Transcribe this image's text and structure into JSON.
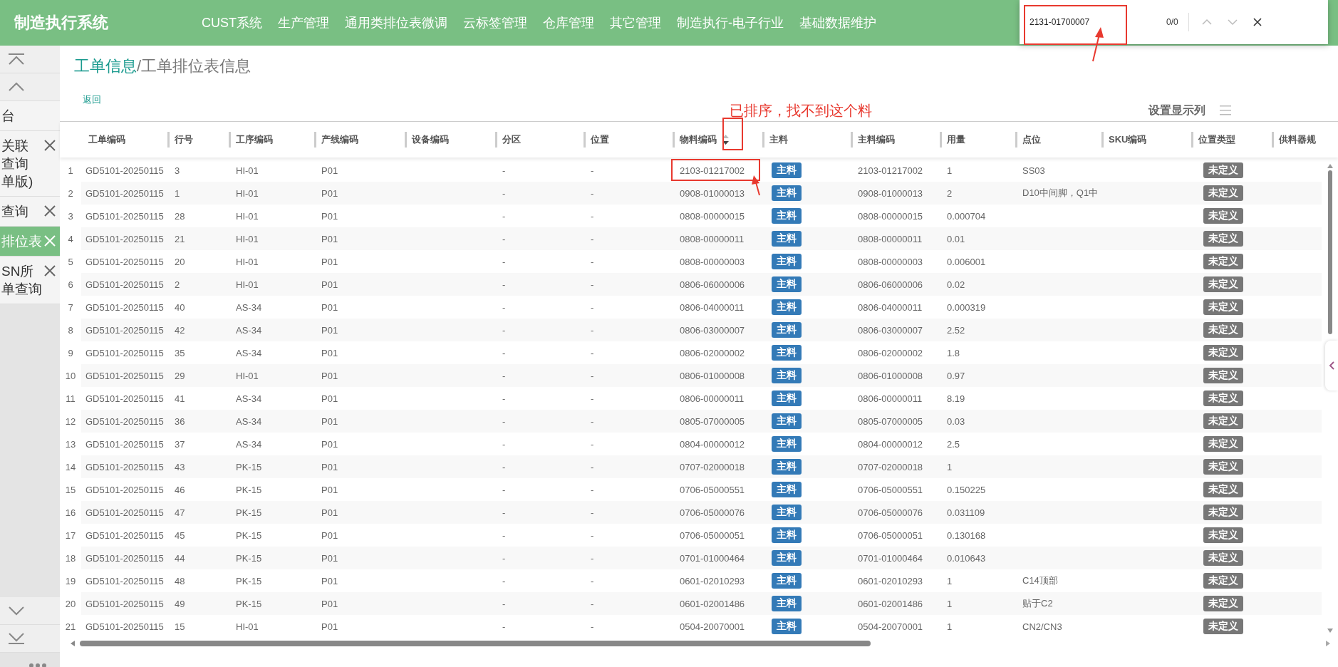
{
  "app": {
    "title": "制造执行系统"
  },
  "nav": [
    "CUST系统",
    "生产管理",
    "通用类排位表微调",
    "云标签管理",
    "仓库管理",
    "其它管理",
    "制造执行-电子行业",
    "基础数据维护"
  ],
  "find_bar": {
    "value": "2131-01700007",
    "count": "0/0"
  },
  "sidebar": {
    "tabs": [
      {
        "label_lines": [
          "台"
        ],
        "closable": false,
        "selected": false
      },
      {
        "label_lines": [
          "关联",
          "查询",
          "单版)"
        ],
        "closable": true,
        "selected": false
      },
      {
        "label_lines": [
          "查询"
        ],
        "closable": true,
        "selected": false
      },
      {
        "label_lines": [
          "排位表"
        ],
        "closable": true,
        "selected": true
      },
      {
        "label_lines": [
          "SN所",
          "单查询"
        ],
        "closable": true,
        "selected": false
      }
    ]
  },
  "breadcrumb": [
    {
      "label": "工单信息",
      "kind": "link"
    },
    {
      "label": "/工单排位表信息",
      "kind": "current"
    }
  ],
  "back_link": "返回",
  "column_settings": "设置显示列",
  "annotation": {
    "text": "已排序，找不到这个料"
  },
  "table": {
    "columns": [
      {
        "label": "工单编码"
      },
      {
        "label": "行号"
      },
      {
        "label": "工序编码"
      },
      {
        "label": "产线编码"
      },
      {
        "label": "设备编码"
      },
      {
        "label": "分区"
      },
      {
        "label": "位置"
      },
      {
        "label": "物料编码",
        "sorted_descending": true
      },
      {
        "label": "主料"
      },
      {
        "label": "主料编码"
      },
      {
        "label": "用量"
      },
      {
        "label": "点位"
      },
      {
        "label": "SKU编码"
      },
      {
        "label": "位置类型"
      },
      {
        "label": "供料器规"
      }
    ],
    "rows": [
      {
        "index": "1",
        "order_code": "GD5101-20250115",
        "line_no": "3",
        "process_code": "HI-01",
        "line_code": "P01",
        "zone": "-",
        "position": "-",
        "material_code": "2103-01217002",
        "main_material": "主料",
        "main_code": "2103-01217002",
        "usage": "1",
        "point": "SS03",
        "position_type": "未定义"
      },
      {
        "index": "2",
        "order_code": "GD5101-20250115",
        "line_no": "1",
        "process_code": "HI-01",
        "line_code": "P01",
        "zone": "-",
        "position": "-",
        "material_code": "0908-01000013",
        "main_material": "主料",
        "main_code": "0908-01000013",
        "usage": "2",
        "point": "D10中间脚，Q1中",
        "position_type": "未定义"
      },
      {
        "index": "3",
        "order_code": "GD5101-20250115",
        "line_no": "28",
        "process_code": "HI-01",
        "line_code": "P01",
        "zone": "-",
        "position": "-",
        "material_code": "0808-00000015",
        "main_material": "主料",
        "main_code": "0808-00000015",
        "usage": "0.000704",
        "position_type": "未定义"
      },
      {
        "index": "4",
        "order_code": "GD5101-20250115",
        "line_no": "21",
        "process_code": "HI-01",
        "line_code": "P01",
        "zone": "-",
        "position": "-",
        "material_code": "0808-00000011",
        "main_material": "主料",
        "main_code": "0808-00000011",
        "usage": "0.01",
        "position_type": "未定义"
      },
      {
        "index": "5",
        "order_code": "GD5101-20250115",
        "line_no": "20",
        "process_code": "HI-01",
        "line_code": "P01",
        "zone": "-",
        "position": "-",
        "material_code": "0808-00000003",
        "main_material": "主料",
        "main_code": "0808-00000003",
        "usage": "0.006001",
        "position_type": "未定义"
      },
      {
        "index": "6",
        "order_code": "GD5101-20250115",
        "line_no": "2",
        "process_code": "HI-01",
        "line_code": "P01",
        "zone": "-",
        "position": "-",
        "material_code": "0806-06000006",
        "main_material": "主料",
        "main_code": "0806-06000006",
        "usage": "0.02",
        "position_type": "未定义"
      },
      {
        "index": "7",
        "order_code": "GD5101-20250115",
        "line_no": "40",
        "process_code": "AS-34",
        "line_code": "P01",
        "zone": "-",
        "position": "-",
        "material_code": "0806-04000011",
        "main_material": "主料",
        "main_code": "0806-04000011",
        "usage": "0.000319",
        "position_type": "未定义"
      },
      {
        "index": "8",
        "order_code": "GD5101-20250115",
        "line_no": "42",
        "process_code": "AS-34",
        "line_code": "P01",
        "zone": "-",
        "position": "-",
        "material_code": "0806-03000007",
        "main_material": "主料",
        "main_code": "0806-03000007",
        "usage": "2.52",
        "position_type": "未定义"
      },
      {
        "index": "9",
        "order_code": "GD5101-20250115",
        "line_no": "35",
        "process_code": "AS-34",
        "line_code": "P01",
        "zone": "-",
        "position": "-",
        "material_code": "0806-02000002",
        "main_material": "主料",
        "main_code": "0806-02000002",
        "usage": "1.8",
        "position_type": "未定义"
      },
      {
        "index": "10",
        "order_code": "GD5101-20250115",
        "line_no": "29",
        "process_code": "HI-01",
        "line_code": "P01",
        "zone": "-",
        "position": "-",
        "material_code": "0806-01000008",
        "main_material": "主料",
        "main_code": "0806-01000008",
        "usage": "0.97",
        "position_type": "未定义"
      },
      {
        "index": "11",
        "order_code": "GD5101-20250115",
        "line_no": "41",
        "process_code": "AS-34",
        "line_code": "P01",
        "zone": "-",
        "position": "-",
        "material_code": "0806-00000011",
        "main_material": "主料",
        "main_code": "0806-00000011",
        "usage": "8.19",
        "position_type": "未定义"
      },
      {
        "index": "12",
        "order_code": "GD5101-20250115",
        "line_no": "36",
        "process_code": "AS-34",
        "line_code": "P01",
        "zone": "-",
        "position": "-",
        "material_code": "0805-07000005",
        "main_material": "主料",
        "main_code": "0805-07000005",
        "usage": "0.03",
        "position_type": "未定义"
      },
      {
        "index": "13",
        "order_code": "GD5101-20250115",
        "line_no": "37",
        "process_code": "AS-34",
        "line_code": "P01",
        "zone": "-",
        "position": "-",
        "material_code": "0804-00000012",
        "main_material": "主料",
        "main_code": "0804-00000012",
        "usage": "2.5",
        "position_type": "未定义"
      },
      {
        "index": "14",
        "order_code": "GD5101-20250115",
        "line_no": "43",
        "process_code": "PK-15",
        "line_code": "P01",
        "zone": "-",
        "position": "-",
        "material_code": "0707-02000018",
        "main_material": "主料",
        "main_code": "0707-02000018",
        "usage": "1",
        "position_type": "未定义"
      },
      {
        "index": "15",
        "order_code": "GD5101-20250115",
        "line_no": "46",
        "process_code": "PK-15",
        "line_code": "P01",
        "zone": "-",
        "position": "-",
        "material_code": "0706-05000551",
        "main_material": "主料",
        "main_code": "0706-05000551",
        "usage": "0.150225",
        "position_type": "未定义"
      },
      {
        "index": "16",
        "order_code": "GD5101-20250115",
        "line_no": "47",
        "process_code": "PK-15",
        "line_code": "P01",
        "zone": "-",
        "position": "-",
        "material_code": "0706-05000076",
        "main_material": "主料",
        "main_code": "0706-05000076",
        "usage": "0.031109",
        "position_type": "未定义"
      },
      {
        "index": "17",
        "order_code": "GD5101-20250115",
        "line_no": "45",
        "process_code": "PK-15",
        "line_code": "P01",
        "zone": "-",
        "position": "-",
        "material_code": "0706-05000051",
        "main_material": "主料",
        "main_code": "0706-05000051",
        "usage": "0.130168",
        "position_type": "未定义"
      },
      {
        "index": "18",
        "order_code": "GD5101-20250115",
        "line_no": "44",
        "process_code": "PK-15",
        "line_code": "P01",
        "zone": "-",
        "position": "-",
        "material_code": "0701-01000464",
        "main_material": "主料",
        "main_code": "0701-01000464",
        "usage": "0.010643",
        "position_type": "未定义"
      },
      {
        "index": "19",
        "order_code": "GD5101-20250115",
        "line_no": "48",
        "process_code": "PK-15",
        "line_code": "P01",
        "zone": "-",
        "position": "-",
        "material_code": "0601-02010293",
        "main_material": "主料",
        "main_code": "0601-02010293",
        "usage": "1",
        "point": "C14顶部",
        "position_type": "未定义"
      },
      {
        "index": "20",
        "order_code": "GD5101-20250115",
        "line_no": "49",
        "process_code": "PK-15",
        "line_code": "P01",
        "zone": "-",
        "position": "-",
        "material_code": "0601-02001486",
        "main_material": "主料",
        "main_code": "0601-02001486",
        "usage": "1",
        "point": "贴于C2",
        "position_type": "未定义"
      },
      {
        "index": "21",
        "order_code": "GD5101-20250115",
        "line_no": "15",
        "process_code": "HI-01",
        "line_code": "P01",
        "zone": "-",
        "position": "-",
        "material_code": "0504-20070001",
        "main_material": "主料",
        "main_code": "0504-20070001",
        "usage": "1",
        "point": "CN2/CN3",
        "position_type": "未定义"
      }
    ]
  }
}
